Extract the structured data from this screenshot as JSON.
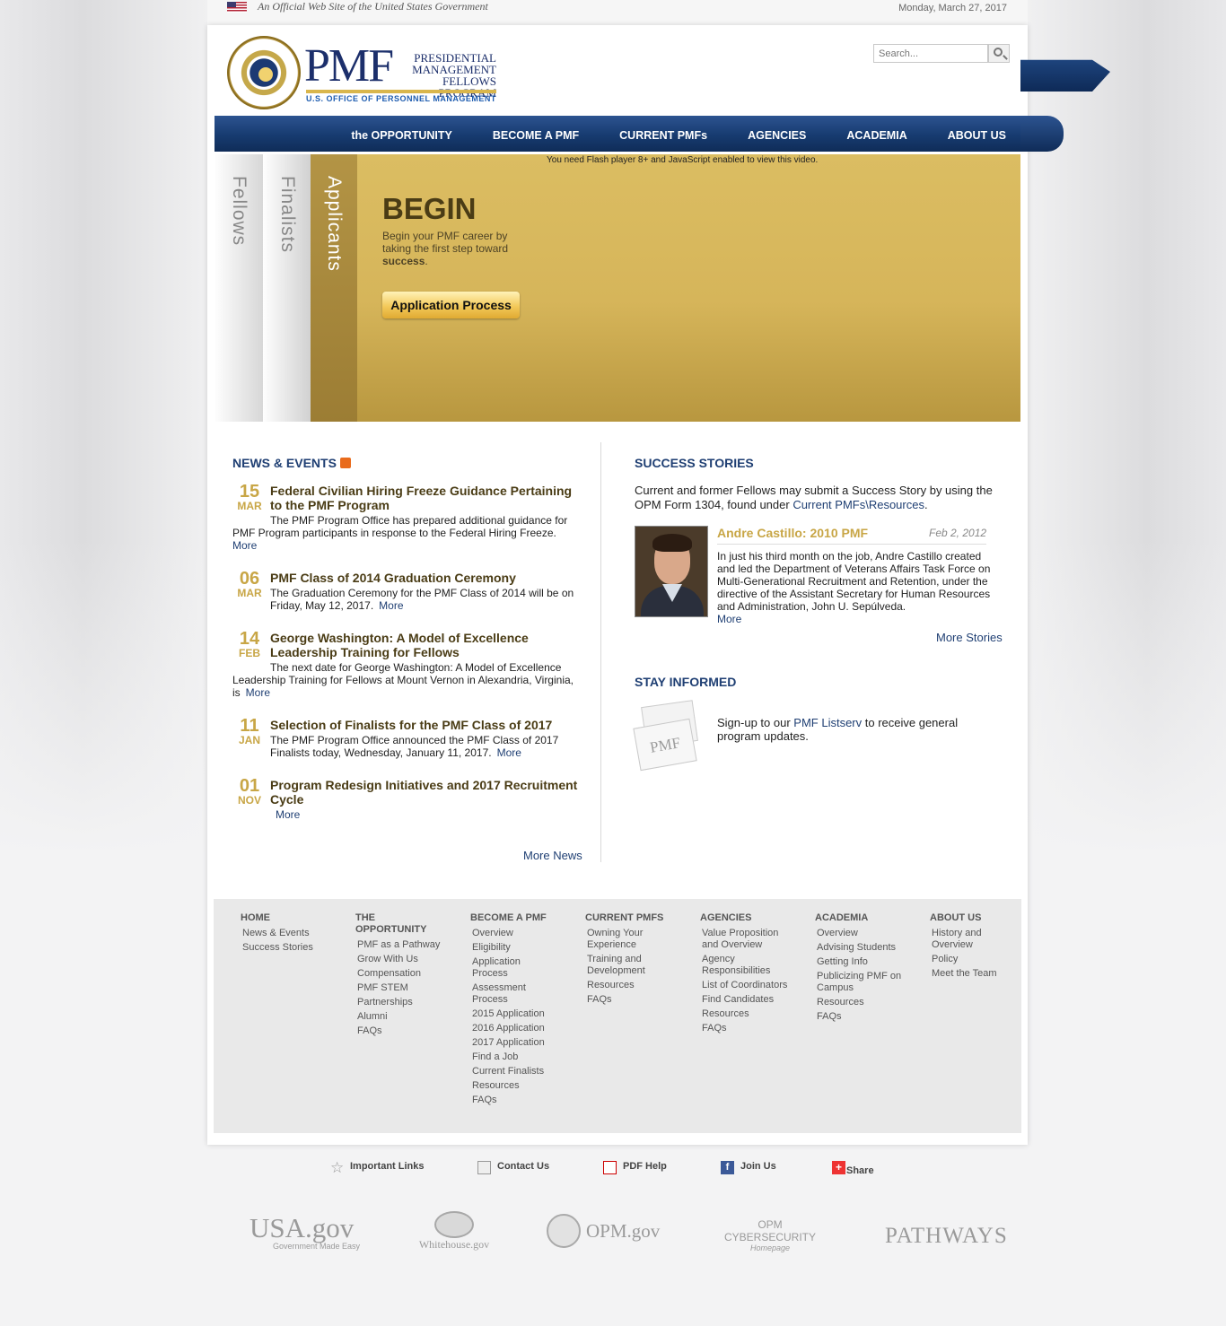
{
  "top": {
    "official": "An Official Web Site of the United States Government",
    "date": "Monday, March 27, 2017"
  },
  "header": {
    "logo_big": "PMF",
    "logo_lines": [
      "PRESIDENTIAL",
      "MANAGEMENT",
      "FELLOWS PROGRAM"
    ],
    "opm": "U.S. OFFICE OF PERSONNEL MANAGEMENT",
    "search_placeholder": "Search..."
  },
  "nav": {
    "items": [
      "the OPPORTUNITY",
      "BECOME A PMF",
      "CURRENT PMFs",
      "AGENCIES",
      "ACADEMIA",
      "ABOUT US"
    ]
  },
  "hero": {
    "tabs": [
      "Fellows",
      "Finalists",
      "Applicants"
    ],
    "flash_note": "You need Flash player 8+ and JavaScript enabled to view this video.",
    "title": "BEGIN",
    "text_prefix": "Begin your PMF career by taking the first step toward ",
    "text_bold": "success",
    "text_suffix": ".",
    "button": "Application Process"
  },
  "news": {
    "title": "NEWS & EVENTS",
    "items": [
      {
        "day": "15",
        "month": "MAR",
        "title": "Federal Civilian Hiring Freeze Guidance Pertaining to the PMF Program",
        "body": "The PMF Program Office has prepared additional guidance for PMF Program participants in response to the Federal Hiring Freeze.",
        "more": "More"
      },
      {
        "day": "06",
        "month": "MAR",
        "title": "PMF Class of 2014 Graduation Ceremony",
        "body": "The Graduation Ceremony for the PMF Class of 2014 will be on Friday, May 12, 2017.",
        "more": "More"
      },
      {
        "day": "14",
        "month": "FEB",
        "title": "George Washington: A Model of Excellence Leadership Training for Fellows",
        "body": "The next date for George Washington: A Model of Excellence Leadership Training for Fellows at Mount Vernon in Alexandria, Virginia, is",
        "more": "More"
      },
      {
        "day": "11",
        "month": "JAN",
        "title": "Selection of Finalists for the PMF Class of 2017",
        "body": "The PMF Program Office announced the PMF Class of 2017 Finalists today, Wednesday, January 11, 2017.",
        "more": "More"
      },
      {
        "day": "01",
        "month": "NOV",
        "title": "Program Redesign Initiatives and 2017 Recruitment Cycle",
        "body": "",
        "more": "More"
      }
    ],
    "more_news": "More News"
  },
  "stories": {
    "title": "SUCCESS STORIES",
    "intro": "Current and former Fellows may submit a Success Story by using the OPM Form 1304, found under ",
    "intro_link": "Current PMFs\\Resources",
    "intro_end": ".",
    "name": "Andre Castillo: 2010 PMF",
    "date": "Feb 2, 2012",
    "text": "In just his third month on the job, Andre Castillo created and led the Department of Veterans Affairs Task Force on Multi-Generational Recruitment and Retention, under the directive of the Assistant Secretary for Human Resources and Administration, John U. Sepúlveda.",
    "more": "More",
    "more_stories": "More Stories"
  },
  "stay": {
    "title": "STAY INFORMED",
    "envelope_label": "PMF",
    "text_prefix": "Sign-up to our ",
    "link": "PMF Listserv",
    "text_suffix": " to receive general program updates."
  },
  "sitemap": [
    {
      "head": "HOME",
      "links": [
        "News & Events",
        "Success Stories"
      ]
    },
    {
      "head": "THE OPPORTUNITY",
      "links": [
        "PMF as a Pathway",
        "Grow With Us",
        "Compensation",
        "PMF STEM",
        "Partnerships",
        "Alumni",
        "FAQs"
      ]
    },
    {
      "head": "BECOME A PMF",
      "links": [
        "Overview",
        "Eligibility",
        "Application Process",
        "Assessment Process",
        "2015 Application",
        "2016 Application",
        "2017 Application",
        "Find a Job",
        "Current Finalists",
        "Resources",
        "FAQs"
      ]
    },
    {
      "head": "CURRENT PMFS",
      "links": [
        "Owning Your Experience",
        "Training and Development",
        "Resources",
        "FAQs"
      ]
    },
    {
      "head": "AGENCIES",
      "links": [
        "Value Proposition and Overview",
        "Agency Responsibilities",
        "List of Coordinators",
        "Find Candidates",
        "Resources",
        "FAQs"
      ]
    },
    {
      "head": "ACADEMIA",
      "links": [
        "Overview",
        "Advising Students",
        "Getting Info",
        "Publicizing PMF on Campus",
        "Resources",
        "FAQs"
      ]
    },
    {
      "head": "ABOUT US",
      "links": [
        "History and Overview",
        "Policy",
        "Meet the Team"
      ]
    }
  ],
  "utility": [
    "Important Links",
    "Contact Us",
    "PDF Help",
    "Join Us",
    "Share"
  ],
  "partner_logos": {
    "usa": "USA.gov",
    "usa_sub": "Government Made Easy",
    "whitehouse": "Whitehouse.gov",
    "opm": "OPM.gov",
    "cyber": "OPM CYBERSECURITY",
    "cyber_sub": "Homepage",
    "pathways": "PATHWAYS"
  }
}
